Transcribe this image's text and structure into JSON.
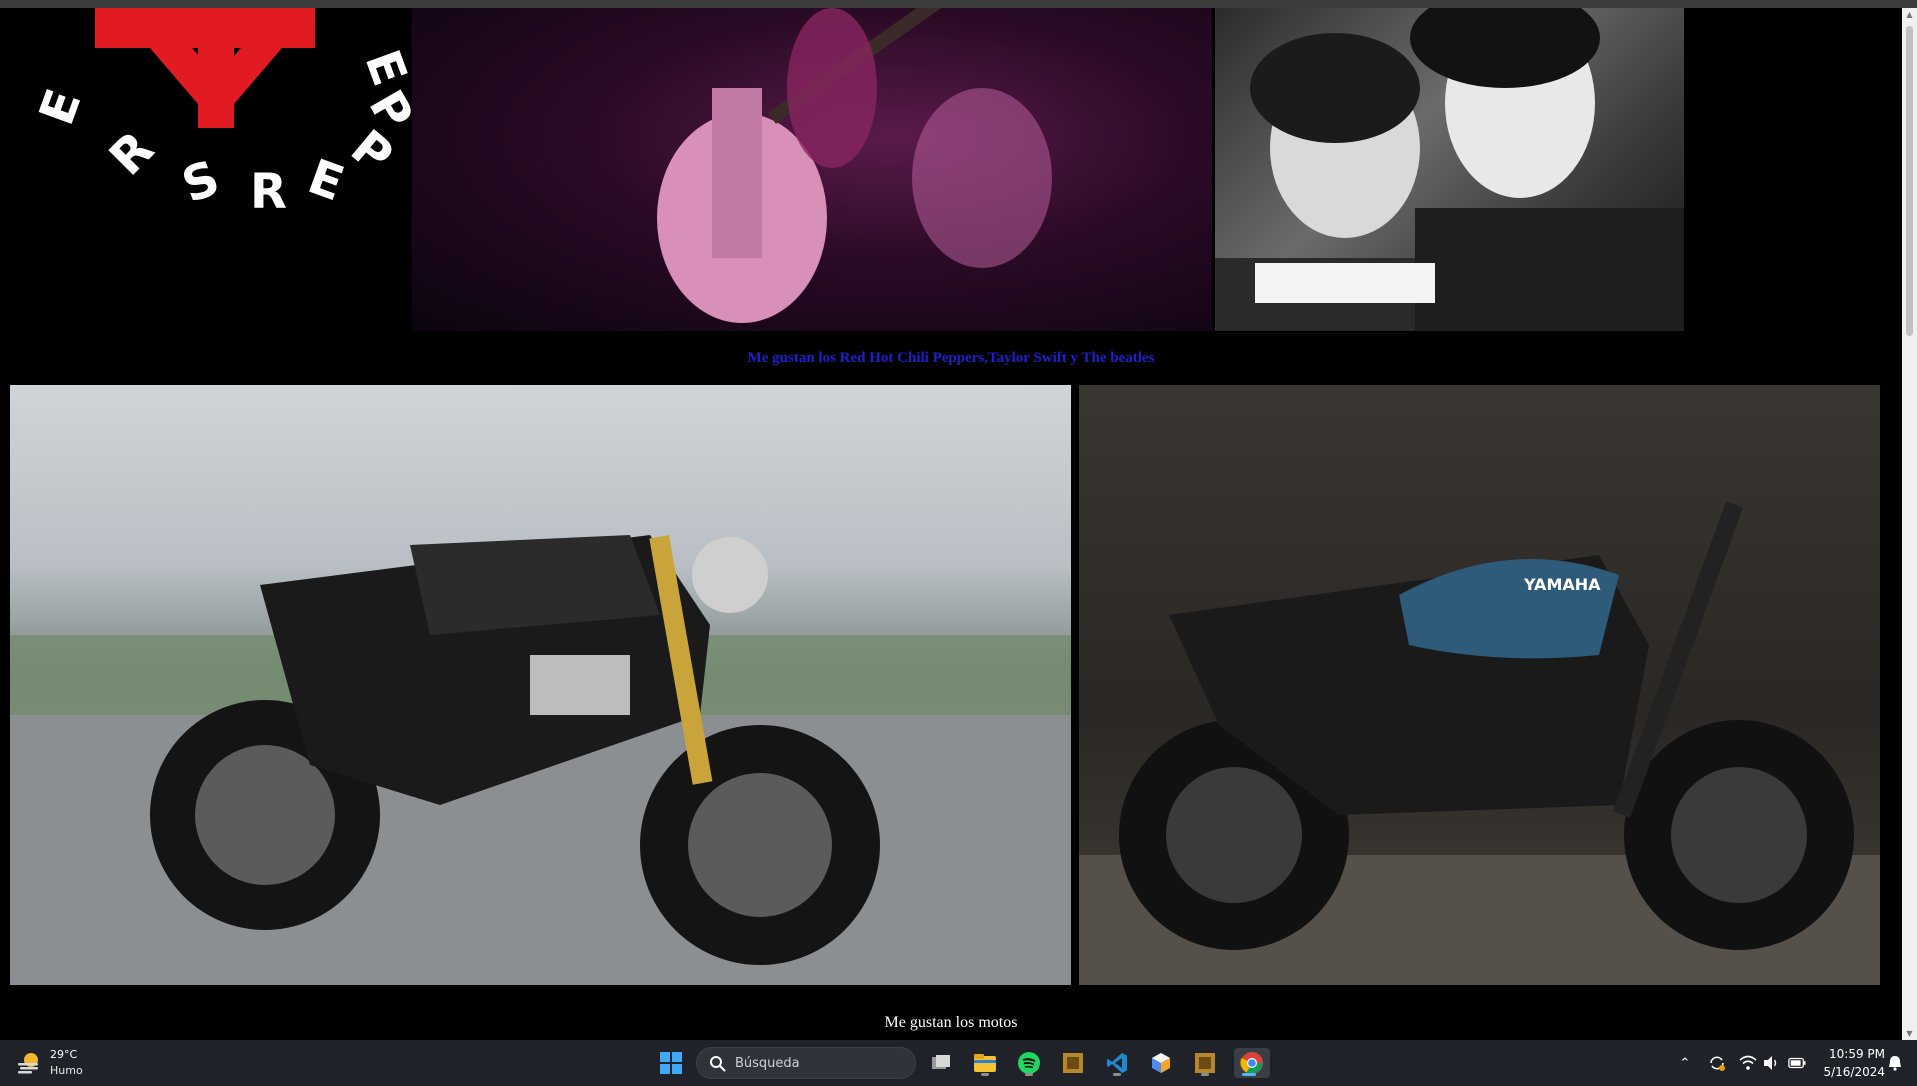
{
  "page": {
    "caption_bands": "Me gustan los Red Hot Chili Peppers,Taylor Swift y The beatles",
    "caption_motos": "Me gustan los motos"
  },
  "images": {
    "rhcp_logo_text": "PEPPERS RE",
    "moto_brand": "YAMAHA"
  },
  "taskbar": {
    "weather_temp": "29°C",
    "weather_condition": "Humo",
    "search_placeholder": "Búsqueda",
    "time": "10:59 PM",
    "date": "5/16/2024"
  },
  "colors": {
    "caption_bands": "#1f1fd0",
    "rhcp_red": "#e21b23",
    "taskbar_bg": "#1f2329"
  }
}
